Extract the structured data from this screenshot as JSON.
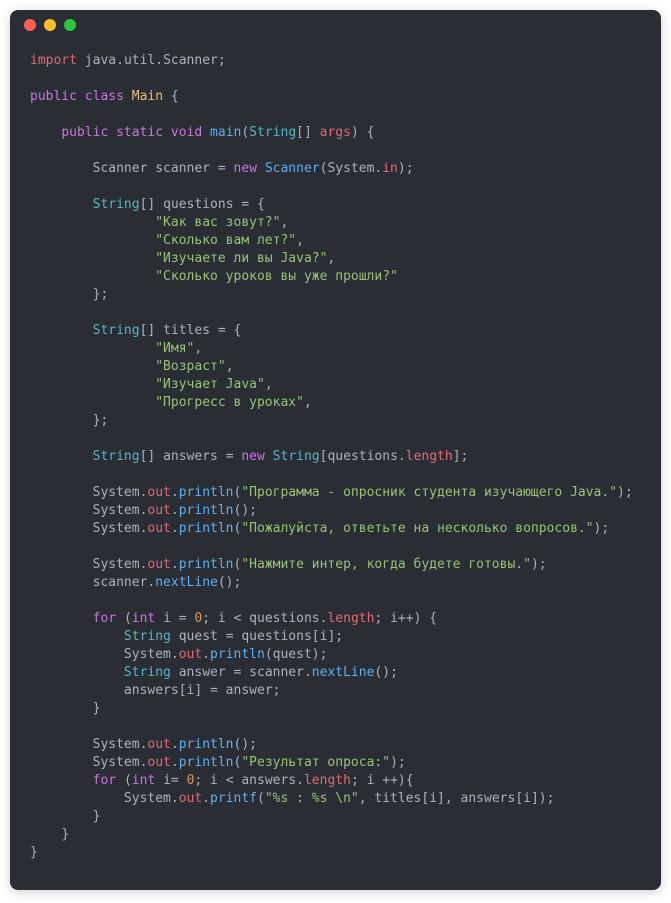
{
  "window": {
    "dots": [
      "red",
      "yellow",
      "green"
    ]
  },
  "tokens": [
    {
      "c": "tok-kw-import",
      "t": "import"
    },
    {
      "c": "tok-plain",
      "t": " java"
    },
    {
      "c": "tok-punc",
      "t": "."
    },
    {
      "c": "tok-plain",
      "t": "util"
    },
    {
      "c": "tok-punc",
      "t": "."
    },
    {
      "c": "tok-plain",
      "t": "Scanner"
    },
    {
      "c": "tok-punc",
      "t": ";"
    },
    {
      "nl": true
    },
    {
      "nl": true
    },
    {
      "c": "tok-kw",
      "t": "public"
    },
    {
      "c": "tok-plain",
      "t": " "
    },
    {
      "c": "tok-kw",
      "t": "class"
    },
    {
      "c": "tok-plain",
      "t": " "
    },
    {
      "c": "tok-class",
      "t": "Main"
    },
    {
      "c": "tok-plain",
      "t": " "
    },
    {
      "c": "tok-punc",
      "t": "{"
    },
    {
      "nl": true
    },
    {
      "nl": true
    },
    {
      "c": "tok-plain",
      "t": "    "
    },
    {
      "c": "tok-kw",
      "t": "public"
    },
    {
      "c": "tok-plain",
      "t": " "
    },
    {
      "c": "tok-kw",
      "t": "static"
    },
    {
      "c": "tok-plain",
      "t": " "
    },
    {
      "c": "tok-kw",
      "t": "void"
    },
    {
      "c": "tok-plain",
      "t": " "
    },
    {
      "c": "tok-method",
      "t": "main"
    },
    {
      "c": "tok-punc",
      "t": "("
    },
    {
      "c": "tok-type",
      "t": "String"
    },
    {
      "c": "tok-punc",
      "t": "[]"
    },
    {
      "c": "tok-plain",
      "t": " "
    },
    {
      "c": "tok-ident",
      "t": "args"
    },
    {
      "c": "tok-punc",
      "t": ")"
    },
    {
      "c": "tok-plain",
      "t": " "
    },
    {
      "c": "tok-punc",
      "t": "{"
    },
    {
      "nl": true
    },
    {
      "nl": true
    },
    {
      "c": "tok-plain",
      "t": "        Scanner scanner "
    },
    {
      "c": "tok-punc",
      "t": "="
    },
    {
      "c": "tok-plain",
      "t": " "
    },
    {
      "c": "tok-kw",
      "t": "new"
    },
    {
      "c": "tok-plain",
      "t": " "
    },
    {
      "c": "tok-method",
      "t": "Scanner"
    },
    {
      "c": "tok-punc",
      "t": "("
    },
    {
      "c": "tok-plain",
      "t": "System"
    },
    {
      "c": "tok-punc",
      "t": "."
    },
    {
      "c": "tok-field",
      "t": "in"
    },
    {
      "c": "tok-punc",
      "t": ");"
    },
    {
      "nl": true
    },
    {
      "nl": true
    },
    {
      "c": "tok-plain",
      "t": "        "
    },
    {
      "c": "tok-type",
      "t": "String"
    },
    {
      "c": "tok-punc",
      "t": "[]"
    },
    {
      "c": "tok-plain",
      "t": " questions "
    },
    {
      "c": "tok-punc",
      "t": "="
    },
    {
      "c": "tok-plain",
      "t": " "
    },
    {
      "c": "tok-punc",
      "t": "{"
    },
    {
      "nl": true
    },
    {
      "c": "tok-plain",
      "t": "                "
    },
    {
      "c": "tok-string",
      "t": "\"Как вас зовут?\""
    },
    {
      "c": "tok-punc",
      "t": ","
    },
    {
      "nl": true
    },
    {
      "c": "tok-plain",
      "t": "                "
    },
    {
      "c": "tok-string",
      "t": "\"Сколько вам лет?\""
    },
    {
      "c": "tok-punc",
      "t": ","
    },
    {
      "nl": true
    },
    {
      "c": "tok-plain",
      "t": "                "
    },
    {
      "c": "tok-string",
      "t": "\"Изучаете ли вы Java?\""
    },
    {
      "c": "tok-punc",
      "t": ","
    },
    {
      "nl": true
    },
    {
      "c": "tok-plain",
      "t": "                "
    },
    {
      "c": "tok-string",
      "t": "\"Сколько уроков вы уже прошли?\""
    },
    {
      "nl": true
    },
    {
      "c": "tok-plain",
      "t": "        "
    },
    {
      "c": "tok-punc",
      "t": "};"
    },
    {
      "nl": true
    },
    {
      "nl": true
    },
    {
      "c": "tok-plain",
      "t": "        "
    },
    {
      "c": "tok-type",
      "t": "String"
    },
    {
      "c": "tok-punc",
      "t": "[]"
    },
    {
      "c": "tok-plain",
      "t": " titles "
    },
    {
      "c": "tok-punc",
      "t": "="
    },
    {
      "c": "tok-plain",
      "t": " "
    },
    {
      "c": "tok-punc",
      "t": "{"
    },
    {
      "nl": true
    },
    {
      "c": "tok-plain",
      "t": "                "
    },
    {
      "c": "tok-string",
      "t": "\"Имя\""
    },
    {
      "c": "tok-punc",
      "t": ","
    },
    {
      "nl": true
    },
    {
      "c": "tok-plain",
      "t": "                "
    },
    {
      "c": "tok-string",
      "t": "\"Возраст\""
    },
    {
      "c": "tok-punc",
      "t": ","
    },
    {
      "nl": true
    },
    {
      "c": "tok-plain",
      "t": "                "
    },
    {
      "c": "tok-string",
      "t": "\"Изучает Java\""
    },
    {
      "c": "tok-punc",
      "t": ","
    },
    {
      "nl": true
    },
    {
      "c": "tok-plain",
      "t": "                "
    },
    {
      "c": "tok-string",
      "t": "\"Прогресс в уроках\""
    },
    {
      "c": "tok-punc",
      "t": ","
    },
    {
      "nl": true
    },
    {
      "c": "tok-plain",
      "t": "        "
    },
    {
      "c": "tok-punc",
      "t": "};"
    },
    {
      "nl": true
    },
    {
      "nl": true
    },
    {
      "c": "tok-plain",
      "t": "        "
    },
    {
      "c": "tok-type",
      "t": "String"
    },
    {
      "c": "tok-punc",
      "t": "[]"
    },
    {
      "c": "tok-plain",
      "t": " answers "
    },
    {
      "c": "tok-punc",
      "t": "="
    },
    {
      "c": "tok-plain",
      "t": " "
    },
    {
      "c": "tok-kw",
      "t": "new"
    },
    {
      "c": "tok-plain",
      "t": " "
    },
    {
      "c": "tok-type",
      "t": "String"
    },
    {
      "c": "tok-punc",
      "t": "["
    },
    {
      "c": "tok-plain",
      "t": "questions"
    },
    {
      "c": "tok-punc",
      "t": "."
    },
    {
      "c": "tok-ident",
      "t": "length"
    },
    {
      "c": "tok-punc",
      "t": "];"
    },
    {
      "nl": true
    },
    {
      "nl": true
    },
    {
      "c": "tok-plain",
      "t": "        System"
    },
    {
      "c": "tok-punc",
      "t": "."
    },
    {
      "c": "tok-ident",
      "t": "out"
    },
    {
      "c": "tok-punc",
      "t": "."
    },
    {
      "c": "tok-method",
      "t": "println"
    },
    {
      "c": "tok-punc",
      "t": "("
    },
    {
      "c": "tok-string",
      "t": "\"Программа - опросник студента изучающего Java.\""
    },
    {
      "c": "tok-punc",
      "t": ");"
    },
    {
      "nl": true
    },
    {
      "c": "tok-plain",
      "t": "        System"
    },
    {
      "c": "tok-punc",
      "t": "."
    },
    {
      "c": "tok-ident",
      "t": "out"
    },
    {
      "c": "tok-punc",
      "t": "."
    },
    {
      "c": "tok-method",
      "t": "println"
    },
    {
      "c": "tok-punc",
      "t": "();"
    },
    {
      "nl": true
    },
    {
      "c": "tok-plain",
      "t": "        System"
    },
    {
      "c": "tok-punc",
      "t": "."
    },
    {
      "c": "tok-ident",
      "t": "out"
    },
    {
      "c": "tok-punc",
      "t": "."
    },
    {
      "c": "tok-method",
      "t": "println"
    },
    {
      "c": "tok-punc",
      "t": "("
    },
    {
      "c": "tok-string",
      "t": "\"Пожалуйста, ответьте на несколько вопросов.\""
    },
    {
      "c": "tok-punc",
      "t": ");"
    },
    {
      "nl": true
    },
    {
      "nl": true
    },
    {
      "c": "tok-plain",
      "t": "        System"
    },
    {
      "c": "tok-punc",
      "t": "."
    },
    {
      "c": "tok-ident",
      "t": "out"
    },
    {
      "c": "tok-punc",
      "t": "."
    },
    {
      "c": "tok-method",
      "t": "println"
    },
    {
      "c": "tok-punc",
      "t": "("
    },
    {
      "c": "tok-string",
      "t": "\"Нажмите интер, когда будете готовы.\""
    },
    {
      "c": "tok-punc",
      "t": ");"
    },
    {
      "nl": true
    },
    {
      "c": "tok-plain",
      "t": "        scanner"
    },
    {
      "c": "tok-punc",
      "t": "."
    },
    {
      "c": "tok-method",
      "t": "nextLine"
    },
    {
      "c": "tok-punc",
      "t": "();"
    },
    {
      "nl": true
    },
    {
      "nl": true
    },
    {
      "c": "tok-plain",
      "t": "        "
    },
    {
      "c": "tok-kw",
      "t": "for"
    },
    {
      "c": "tok-plain",
      "t": " "
    },
    {
      "c": "tok-punc",
      "t": "("
    },
    {
      "c": "tok-kw",
      "t": "int"
    },
    {
      "c": "tok-plain",
      "t": " i "
    },
    {
      "c": "tok-punc",
      "t": "="
    },
    {
      "c": "tok-plain",
      "t": " "
    },
    {
      "c": "tok-num",
      "t": "0"
    },
    {
      "c": "tok-punc",
      "t": ";"
    },
    {
      "c": "tok-plain",
      "t": " i "
    },
    {
      "c": "tok-punc",
      "t": "<"
    },
    {
      "c": "tok-plain",
      "t": " questions"
    },
    {
      "c": "tok-punc",
      "t": "."
    },
    {
      "c": "tok-ident",
      "t": "length"
    },
    {
      "c": "tok-punc",
      "t": ";"
    },
    {
      "c": "tok-plain",
      "t": " i"
    },
    {
      "c": "tok-punc",
      "t": "++)"
    },
    {
      "c": "tok-plain",
      "t": " "
    },
    {
      "c": "tok-punc",
      "t": "{"
    },
    {
      "nl": true
    },
    {
      "c": "tok-plain",
      "t": "            "
    },
    {
      "c": "tok-type",
      "t": "String"
    },
    {
      "c": "tok-plain",
      "t": " quest "
    },
    {
      "c": "tok-punc",
      "t": "="
    },
    {
      "c": "tok-plain",
      "t": " questions"
    },
    {
      "c": "tok-punc",
      "t": "["
    },
    {
      "c": "tok-plain",
      "t": "i"
    },
    {
      "c": "tok-punc",
      "t": "];"
    },
    {
      "nl": true
    },
    {
      "c": "tok-plain",
      "t": "            System"
    },
    {
      "c": "tok-punc",
      "t": "."
    },
    {
      "c": "tok-ident",
      "t": "out"
    },
    {
      "c": "tok-punc",
      "t": "."
    },
    {
      "c": "tok-method",
      "t": "println"
    },
    {
      "c": "tok-punc",
      "t": "("
    },
    {
      "c": "tok-plain",
      "t": "quest"
    },
    {
      "c": "tok-punc",
      "t": ");"
    },
    {
      "nl": true
    },
    {
      "c": "tok-plain",
      "t": "            "
    },
    {
      "c": "tok-type",
      "t": "String"
    },
    {
      "c": "tok-plain",
      "t": " answer "
    },
    {
      "c": "tok-punc",
      "t": "="
    },
    {
      "c": "tok-plain",
      "t": " scanner"
    },
    {
      "c": "tok-punc",
      "t": "."
    },
    {
      "c": "tok-method",
      "t": "nextLine"
    },
    {
      "c": "tok-punc",
      "t": "();"
    },
    {
      "nl": true
    },
    {
      "c": "tok-plain",
      "t": "            answers"
    },
    {
      "c": "tok-punc",
      "t": "["
    },
    {
      "c": "tok-plain",
      "t": "i"
    },
    {
      "c": "tok-punc",
      "t": "]"
    },
    {
      "c": "tok-plain",
      "t": " "
    },
    {
      "c": "tok-punc",
      "t": "="
    },
    {
      "c": "tok-plain",
      "t": " answer"
    },
    {
      "c": "tok-punc",
      "t": ";"
    },
    {
      "nl": true
    },
    {
      "c": "tok-plain",
      "t": "        "
    },
    {
      "c": "tok-punc",
      "t": "}"
    },
    {
      "nl": true
    },
    {
      "nl": true
    },
    {
      "c": "tok-plain",
      "t": "        System"
    },
    {
      "c": "tok-punc",
      "t": "."
    },
    {
      "c": "tok-ident",
      "t": "out"
    },
    {
      "c": "tok-punc",
      "t": "."
    },
    {
      "c": "tok-method",
      "t": "println"
    },
    {
      "c": "tok-punc",
      "t": "();"
    },
    {
      "nl": true
    },
    {
      "c": "tok-plain",
      "t": "        System"
    },
    {
      "c": "tok-punc",
      "t": "."
    },
    {
      "c": "tok-ident",
      "t": "out"
    },
    {
      "c": "tok-punc",
      "t": "."
    },
    {
      "c": "tok-method",
      "t": "println"
    },
    {
      "c": "tok-punc",
      "t": "("
    },
    {
      "c": "tok-string",
      "t": "\"Результат опроса:\""
    },
    {
      "c": "tok-punc",
      "t": ");"
    },
    {
      "nl": true
    },
    {
      "c": "tok-plain",
      "t": "        "
    },
    {
      "c": "tok-kw",
      "t": "for"
    },
    {
      "c": "tok-plain",
      "t": " "
    },
    {
      "c": "tok-punc",
      "t": "("
    },
    {
      "c": "tok-kw",
      "t": "int"
    },
    {
      "c": "tok-plain",
      "t": " i"
    },
    {
      "c": "tok-punc",
      "t": "="
    },
    {
      "c": "tok-plain",
      "t": " "
    },
    {
      "c": "tok-num",
      "t": "0"
    },
    {
      "c": "tok-punc",
      "t": ";"
    },
    {
      "c": "tok-plain",
      "t": " i "
    },
    {
      "c": "tok-punc",
      "t": "<"
    },
    {
      "c": "tok-plain",
      "t": " answers"
    },
    {
      "c": "tok-punc",
      "t": "."
    },
    {
      "c": "tok-ident",
      "t": "length"
    },
    {
      "c": "tok-punc",
      "t": ";"
    },
    {
      "c": "tok-plain",
      "t": " i "
    },
    {
      "c": "tok-punc",
      "t": "++){"
    },
    {
      "nl": true
    },
    {
      "c": "tok-plain",
      "t": "            System"
    },
    {
      "c": "tok-punc",
      "t": "."
    },
    {
      "c": "tok-ident",
      "t": "out"
    },
    {
      "c": "tok-punc",
      "t": "."
    },
    {
      "c": "tok-method",
      "t": "printf"
    },
    {
      "c": "tok-punc",
      "t": "("
    },
    {
      "c": "tok-string",
      "t": "\"%s : %s \\n\""
    },
    {
      "c": "tok-punc",
      "t": ","
    },
    {
      "c": "tok-plain",
      "t": " titles"
    },
    {
      "c": "tok-punc",
      "t": "["
    },
    {
      "c": "tok-plain",
      "t": "i"
    },
    {
      "c": "tok-punc",
      "t": "],"
    },
    {
      "c": "tok-plain",
      "t": " answers"
    },
    {
      "c": "tok-punc",
      "t": "["
    },
    {
      "c": "tok-plain",
      "t": "i"
    },
    {
      "c": "tok-punc",
      "t": "]);"
    },
    {
      "nl": true
    },
    {
      "c": "tok-plain",
      "t": "        "
    },
    {
      "c": "tok-punc",
      "t": "}"
    },
    {
      "nl": true
    },
    {
      "c": "tok-plain",
      "t": "    "
    },
    {
      "c": "tok-punc",
      "t": "}"
    },
    {
      "nl": true
    },
    {
      "c": "tok-punc",
      "t": "}"
    }
  ]
}
